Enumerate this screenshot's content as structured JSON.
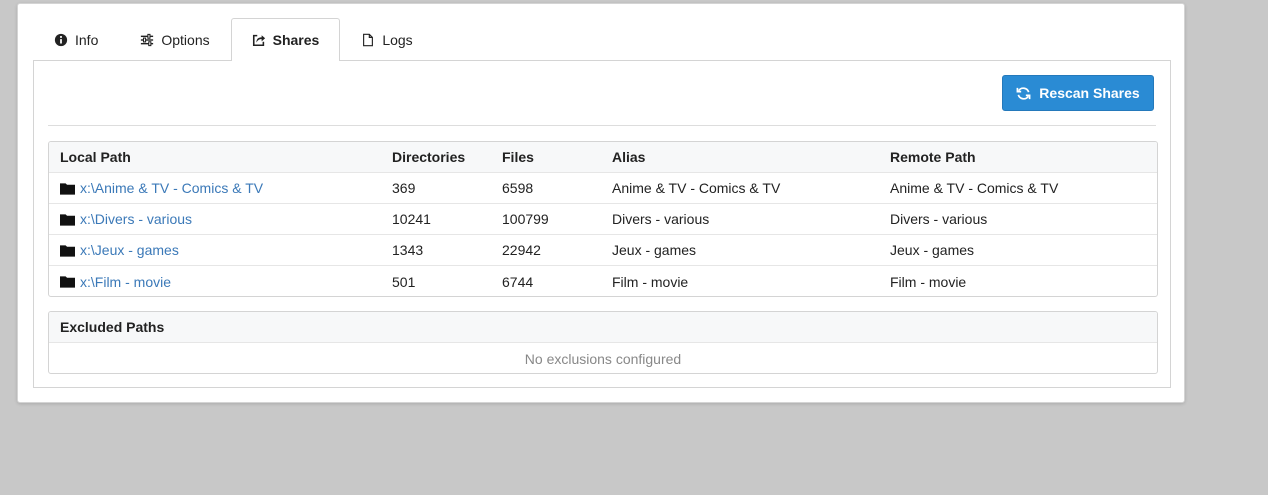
{
  "tabs": [
    {
      "label": "Info",
      "icon": "info-circle-icon"
    },
    {
      "label": "Options",
      "icon": "sliders-icon"
    },
    {
      "label": "Shares",
      "icon": "share-square-icon",
      "active": true
    },
    {
      "label": "Logs",
      "icon": "file-icon"
    }
  ],
  "toolbar": {
    "rescan_label": "Rescan Shares"
  },
  "shares": {
    "columns": [
      "Local Path",
      "Directories",
      "Files",
      "Alias",
      "Remote Path"
    ],
    "rows": [
      {
        "local_path": "x:\\Anime & TV - Comics & TV",
        "directories": "369",
        "files": "6598",
        "alias": "Anime & TV - Comics & TV",
        "remote_path": "Anime & TV - Comics & TV"
      },
      {
        "local_path": "x:\\Divers - various",
        "directories": "10241",
        "files": "100799",
        "alias": "Divers - various",
        "remote_path": "Divers - various"
      },
      {
        "local_path": "x:\\Jeux - games",
        "directories": "1343",
        "files": "22942",
        "alias": "Jeux - games",
        "remote_path": "Jeux - games"
      },
      {
        "local_path": "x:\\Film - movie",
        "directories": "501",
        "files": "6744",
        "alias": "Film - movie",
        "remote_path": "Film - movie"
      }
    ]
  },
  "excluded": {
    "title": "Excluded Paths",
    "empty_text": "No exclusions configured"
  },
  "colors": {
    "accent": "#2a8bd4",
    "link": "#3b79b8",
    "background": "#c8c8c8"
  }
}
